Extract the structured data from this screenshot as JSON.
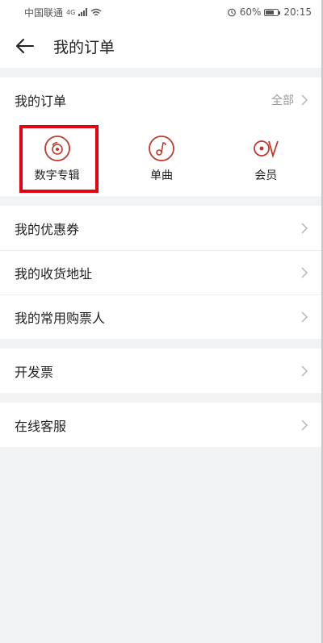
{
  "status_bar": {
    "carrier": "中国联通",
    "network": "4G",
    "battery_percent": "60%",
    "time": "20:15"
  },
  "header": {
    "title": "我的订单"
  },
  "orders": {
    "label": "我的订单",
    "all_label": "全部",
    "items": [
      {
        "label": "数字专辑",
        "icon": "disc-icon"
      },
      {
        "label": "单曲",
        "icon": "music-note-icon"
      },
      {
        "label": "会员",
        "icon": "vip-icon"
      }
    ]
  },
  "section2": [
    {
      "label": "我的优惠券"
    },
    {
      "label": "我的收货地址"
    },
    {
      "label": "我的常用购票人"
    }
  ],
  "section3": [
    {
      "label": "开发票"
    }
  ],
  "section4": [
    {
      "label": "在线客服"
    }
  ],
  "colors": {
    "accent": "#c0392b",
    "highlight": "#e60012",
    "background": "#f2f3f5"
  }
}
